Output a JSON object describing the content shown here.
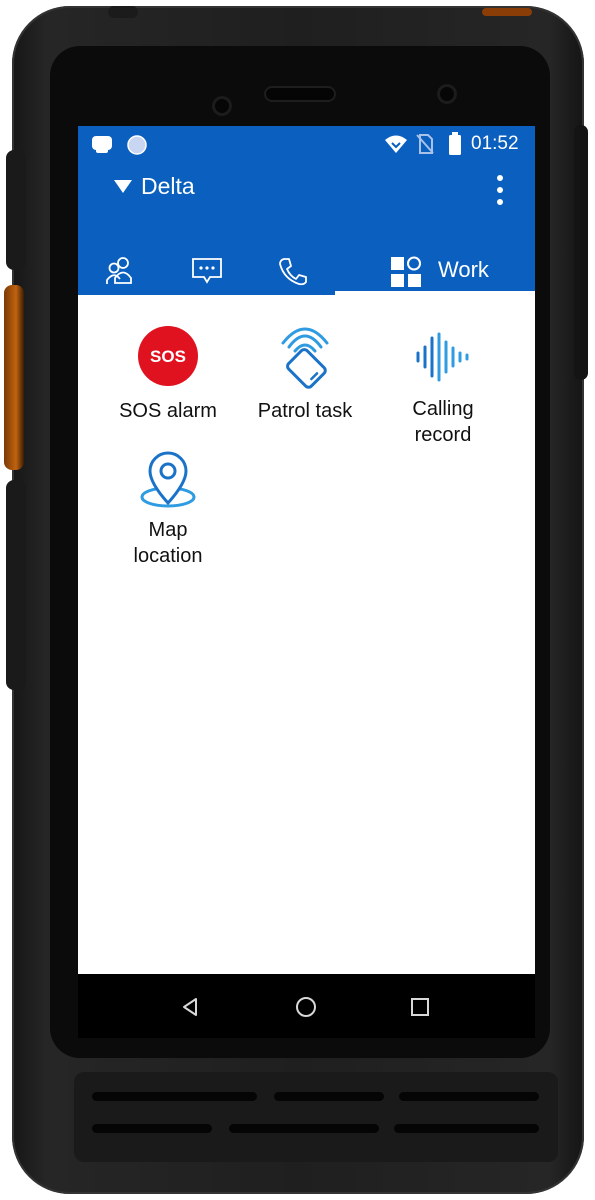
{
  "status_bar": {
    "time": "01:52",
    "icons": [
      "notification-icon",
      "sync-icon",
      "wifi-icon",
      "no-sim-icon",
      "battery-icon"
    ]
  },
  "header": {
    "title": "Delta",
    "dropdown_icon": "dropdown-triangle-icon",
    "menu_icon": "more-vertical-icon"
  },
  "tabs": [
    {
      "id": "contacts",
      "icon": "contacts-icon",
      "label": ""
    },
    {
      "id": "messages",
      "icon": "message-icon",
      "label": ""
    },
    {
      "id": "calls",
      "icon": "phone-icon",
      "label": ""
    },
    {
      "id": "work",
      "icon": "apps-grid-icon",
      "label": "Work",
      "selected": true
    }
  ],
  "work_items": [
    {
      "label": "SOS alarm",
      "icon": "sos-icon",
      "icon_text": "SOS"
    },
    {
      "label": "Patrol task",
      "icon": "nfc-patrol-icon"
    },
    {
      "label": "Calling record",
      "label_lines": [
        "Calling",
        "record"
      ],
      "icon": "sound-wave-icon"
    },
    {
      "label": "Map location",
      "label_lines": [
        "Map",
        "location"
      ],
      "icon": "map-pin-icon"
    }
  ],
  "nav_bar": [
    "back-icon",
    "home-icon",
    "recents-icon"
  ],
  "colors": {
    "app_bar": "#0a5fbf",
    "sos_red": "#e0121f",
    "icon_blue": "#1a73c8",
    "icon_light_blue": "#2f9be0"
  }
}
